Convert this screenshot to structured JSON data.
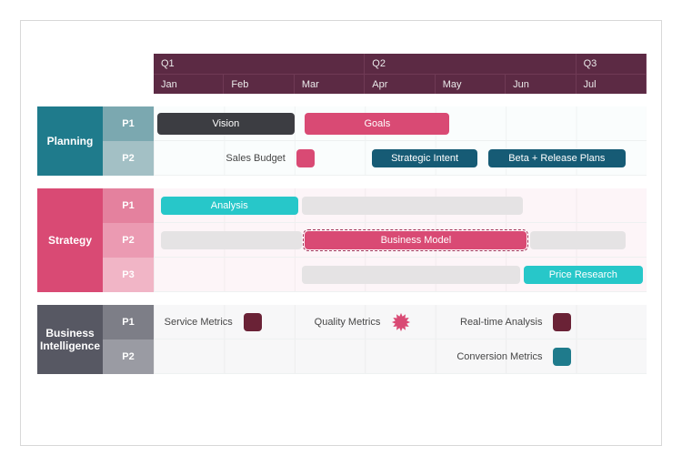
{
  "chart_data": {
    "type": "gantt",
    "quarters": [
      {
        "label": "Q1",
        "span_months": 3
      },
      {
        "label": "Q2",
        "span_months": 3
      },
      {
        "label": "Q3",
        "span_months": 1
      }
    ],
    "months": [
      "Jan",
      "Feb",
      "Mar",
      "Apr",
      "May",
      "Jun",
      "Jul"
    ],
    "groups": [
      {
        "name": "Planning",
        "color": "#1f7b8c",
        "rows": [
          {
            "label": "P1",
            "bg": "teal",
            "items": [
              {
                "kind": "bar",
                "label": "Vision",
                "start": 0.05,
                "end": 2.0,
                "color": "#3c3d42"
              },
              {
                "kind": "bar",
                "label": "Goals",
                "start": 2.15,
                "end": 4.2,
                "color": "#d94a74"
              }
            ]
          },
          {
            "label": "P2",
            "bg": "teal",
            "items": [
              {
                "kind": "label+marker",
                "label": "Sales Budget",
                "marker_at": 2.0,
                "marker_color": "#d94a74"
              },
              {
                "kind": "bar",
                "label": "Strategic Intent",
                "start": 3.1,
                "end": 4.6,
                "color": "#165b75",
                "thin": true
              },
              {
                "kind": "bar",
                "label": "Beta + Release Plans",
                "start": 4.75,
                "end": 6.7,
                "color": "#165b75",
                "thin": true
              }
            ]
          }
        ]
      },
      {
        "name": "Strategy",
        "color": "#d94a74",
        "rows": [
          {
            "label": "P1",
            "bg": "pink",
            "items": [
              {
                "kind": "bar",
                "label": "Analysis",
                "start": 0.1,
                "end": 2.05,
                "color": "#27c7c9",
                "thin": true
              },
              {
                "kind": "ghost",
                "start": 2.1,
                "end": 5.25
              }
            ]
          },
          {
            "label": "P2",
            "bg": "pink",
            "items": [
              {
                "kind": "ghost",
                "start": 0.1,
                "end": 2.1
              },
              {
                "kind": "bar",
                "label": "Business Model",
                "start": 2.15,
                "end": 5.3,
                "color": "#d94a74",
                "dashed": true,
                "thin": true
              },
              {
                "kind": "ghost",
                "start": 5.35,
                "end": 6.7
              }
            ]
          },
          {
            "label": "P3",
            "bg": "pink",
            "items": [
              {
                "kind": "ghost",
                "start": 2.1,
                "end": 5.2
              },
              {
                "kind": "bar",
                "label": "Price Research",
                "start": 5.25,
                "end": 6.95,
                "color": "#27c7c9",
                "thin": true
              }
            ]
          }
        ]
      },
      {
        "name": "Business Intelligence",
        "color": "#575863",
        "rows": [
          {
            "label": "P1",
            "bg": "grey",
            "items": [
              {
                "kind": "label+marker",
                "label": "Service Metrics",
                "marker_at": 1.25,
                "marker_color": "#6a2236",
                "shape": "square"
              },
              {
                "kind": "label+marker",
                "label": "Quality Metrics",
                "marker_at": 3.35,
                "marker_color": "#d94a74",
                "shape": "burst"
              },
              {
                "kind": "label+marker",
                "label": "Real-time Analysis",
                "marker_at": 5.65,
                "marker_color": "#6a2236",
                "shape": "square"
              }
            ]
          },
          {
            "label": "P2",
            "bg": "grey",
            "items": [
              {
                "kind": "label+marker",
                "label": "Conversion Metrics",
                "marker_at": 5.65,
                "marker_color": "#1f7b8c",
                "shape": "square"
              }
            ]
          }
        ]
      }
    ]
  }
}
